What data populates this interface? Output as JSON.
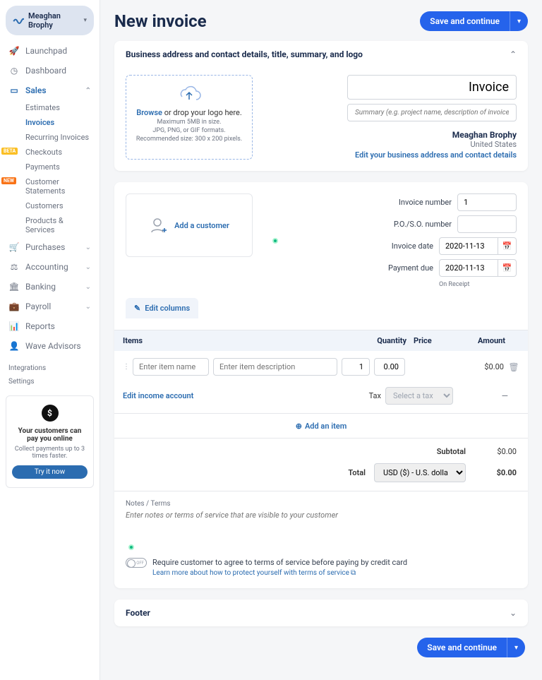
{
  "user": {
    "name": "Meaghan Brophy"
  },
  "nav": {
    "launchpad": "Launchpad",
    "dashboard": "Dashboard",
    "sales": "Sales",
    "sales_items": {
      "estimates": "Estimates",
      "invoices": "Invoices",
      "recurring": "Recurring Invoices",
      "checkouts": "Checkouts",
      "payments": "Payments",
      "statements": "Customer Statements",
      "customers": "Customers",
      "products": "Products & Services"
    },
    "purchases": "Purchases",
    "accounting": "Accounting",
    "banking": "Banking",
    "payroll": "Payroll",
    "reports": "Reports",
    "advisors": "Wave Advisors",
    "integrations": "Integrations",
    "settings": "Settings"
  },
  "badges": {
    "beta": "BETA",
    "new": "NEW"
  },
  "promo": {
    "title": "Your customers can pay you online",
    "sub": "Collect payments up to 3 times faster.",
    "btn": "Try it now"
  },
  "header": {
    "title": "New invoice",
    "save": "Save and continue"
  },
  "biz_section": {
    "title": "Business address and contact details, title, summary, and logo",
    "browse": "Browse",
    "drop_rest": " or drop your logo here.",
    "hint1": "Maximum 5MB in size.",
    "hint2": "JPG, PNG, or GIF formats.",
    "hint3": "Recommended size: 300 x 200 pixels.",
    "invoice_title": "Invoice",
    "summary_ph": "Summary (e.g. project name, description of invoice)",
    "biz_name": "Meaghan Brophy",
    "country": "United States",
    "edit_link": "Edit your business address and contact details"
  },
  "customer": {
    "add": "Add a customer"
  },
  "fields": {
    "inv_num_lbl": "Invoice number",
    "inv_num": "1",
    "po_lbl": "P.O./S.O. number",
    "po": "",
    "date_lbl": "Invoice date",
    "date": "2020-11-13",
    "due_lbl": "Payment due",
    "due": "2020-11-13",
    "receipt": "On Receipt"
  },
  "table": {
    "edit_cols": "Edit columns",
    "h_items": "Items",
    "h_qty": "Quantity",
    "h_price": "Price",
    "h_amount": "Amount",
    "name_ph": "Enter item name",
    "desc_ph": "Enter item description",
    "qty": "1",
    "price": "0.00",
    "amount": "$0.00",
    "income": "Edit income account",
    "tax_lbl": "Tax",
    "tax_ph": "Select a tax",
    "dash": "—",
    "add_item": "Add an item"
  },
  "totals": {
    "subtotal_lbl": "Subtotal",
    "subtotal": "$0.00",
    "total_lbl": "Total",
    "currency": "USD ($) - U.S. dollar",
    "total": "$0.00"
  },
  "notes": {
    "lbl": "Notes / Terms",
    "ph": "Enter notes or terms of service that are visible to your customer"
  },
  "terms": {
    "off": "OFF",
    "text": "Require customer to agree to terms of service before paying by credit card",
    "link": "Learn more about how to protect yourself with terms of service "
  },
  "footer": {
    "title": "Footer"
  }
}
